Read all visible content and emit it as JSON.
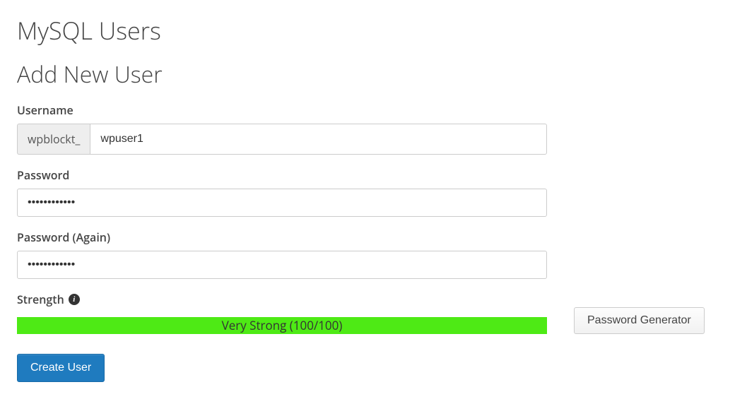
{
  "page": {
    "title": "MySQL Users",
    "subtitle": "Add New User"
  },
  "form": {
    "username_label": "Username",
    "username_prefix": "wpblockt_",
    "username_value": "wpuser1",
    "password_label": "Password",
    "password_value": "••••••••••••",
    "password_again_label": "Password (Again)",
    "password_again_value": "••••••••••••",
    "strength_label": "Strength",
    "strength_text": "Very Strong (100/100)",
    "generator_label": "Password Generator",
    "submit_label": "Create User"
  }
}
